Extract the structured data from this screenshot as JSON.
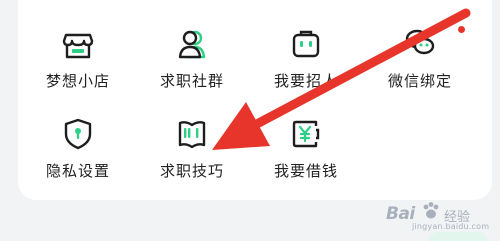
{
  "grid": {
    "row1": [
      {
        "label": "梦想小店",
        "icon": "shop-icon"
      },
      {
        "label": "求职社群",
        "icon": "people-group-icon"
      },
      {
        "label": "我要招人",
        "icon": "briefcase-icon"
      },
      {
        "label": "微信绑定",
        "icon": "wechat-icon"
      }
    ],
    "row2": [
      {
        "label": "隐私设置",
        "icon": "privacy-shield-icon"
      },
      {
        "label": "求职技巧",
        "icon": "open-book-icon"
      },
      {
        "label": "我要借钱",
        "icon": "yuan-wallet-icon"
      }
    ]
  },
  "colors": {
    "accent_green": "#2fcf85",
    "icon_dark": "#1e1e1e",
    "arrow_red": "#e8352b",
    "card_bg": "#ffffff",
    "page_bg": "#f2f3f5"
  },
  "watermark": {
    "logo": "Bai",
    "text": "经验",
    "url": "jingyan.baidu.com"
  }
}
